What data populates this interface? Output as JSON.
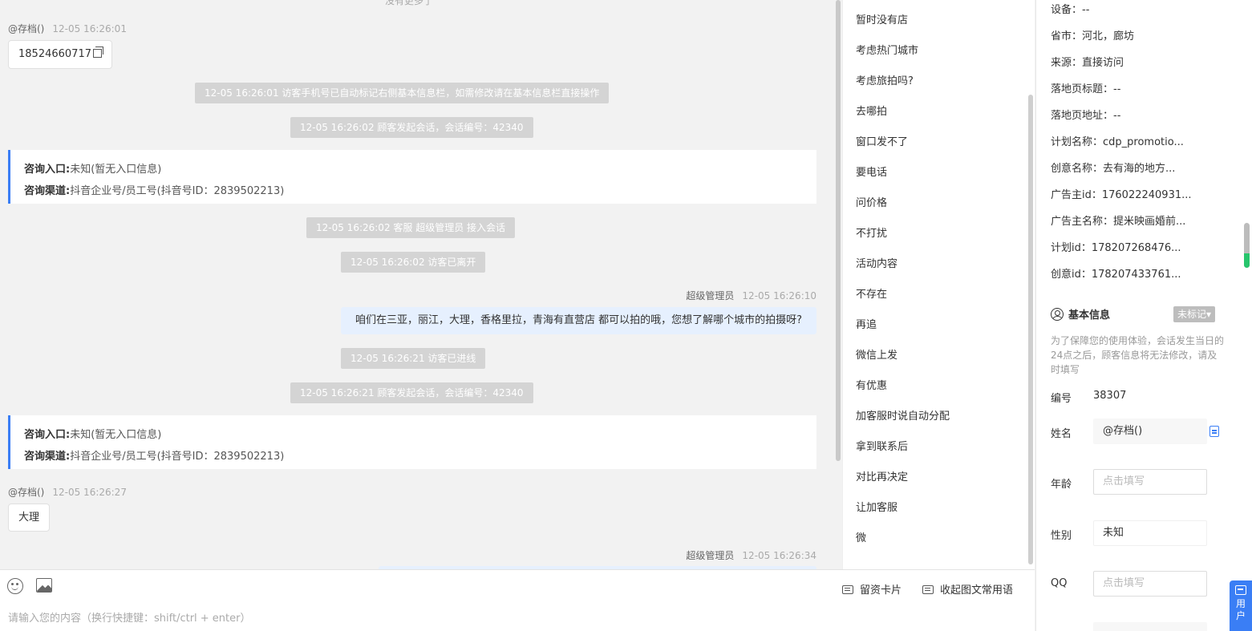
{
  "chat": {
    "top_cut_text": "没有更多了",
    "visitor_name": "@存档()",
    "agent_name": "超级管理员",
    "messages": {
      "m1_time": "12-05 16:26:01",
      "m1_phone": "18524660717",
      "sys1": "12-05 16:26:01 访客手机号已自动标记右侧基本信息栏，如需修改请在基本信息栏直接操作",
      "sys2": "12-05 16:26:02 顾客发起会话，会话编号：42340",
      "consult1_entry_label": "咨询入口:",
      "consult1_entry_value": "未知(暂无入口信息)",
      "consult1_channel_label": "咨询渠道:",
      "consult1_channel_value": "抖音企业号/员工号(抖音号ID：2839502213)",
      "sys3": "12-05 16:26:02 客服 超级管理员 接入会话",
      "sys4": "12-05 16:26:02 访客已离开",
      "m2_time": "12-05 16:26:10",
      "m2_text": "咱们在三亚，丽江，大理，香格里拉，青海有直营店 都可以拍的哦，您想了解哪个城市的拍摄呀?",
      "sys5": "12-05 16:26:21 访客已进线",
      "sys6": "12-05 16:26:21 顾客发起会话，会话编号：42340",
      "consult2_entry_label": "咨询入口:",
      "consult2_entry_value": "未知(暂无入口信息)",
      "consult2_channel_label": "咨询渠道:",
      "consult2_channel_value": "抖音企业号/员工号(抖音号ID：2839502213)",
      "m3_time": "12-05 16:26:27",
      "m3_text": "大理",
      "m4_time": "12-05 16:26:34"
    }
  },
  "input": {
    "placeholder": "请输入您的内容（换行快捷键：shift/ctrl + enter）",
    "card_button": "留资卡片",
    "collapse_button": "收起图文常用语"
  },
  "quick_replies": [
    "暂时没有店",
    "考虑热门城市",
    "考虑旅拍吗?",
    "去哪拍",
    "窗口发不了",
    "要电话",
    "问价格",
    "不打扰",
    "活动内容",
    "不存在",
    "再追",
    "微信上发",
    "有优惠",
    "加客服时说自动分配",
    "拿到联系后",
    "对比再决定",
    "让加客服",
    "微"
  ],
  "info": {
    "rows": [
      "设备：--",
      "省市：河北，廊坊",
      "来源：直接访问",
      "落地页标题：--",
      "落地页地址：--",
      "计划名称：cdp_promotio...",
      "创意名称：去有海的地方...",
      "广告主id：176022240931...",
      "广告主名称：提米映画婚前...",
      "计划id：178207268476...",
      "创意id：178207433761..."
    ],
    "section_title": "基本信息",
    "tag_label": "未标记▾",
    "notice": "为了保障您的使用体验，会话发生当日的24点之后，顾客信息将无法修改，请及时填写",
    "id_label": "编号",
    "id_value": "38307",
    "name_label": "姓名",
    "name_value": "@存档()",
    "age_label": "年龄",
    "age_placeholder": "点击填写",
    "gender_label": "性别",
    "gender_value": "未知",
    "qq_label": "QQ",
    "qq_placeholder": "点击填写"
  },
  "user_float": [
    "用",
    "户"
  ]
}
